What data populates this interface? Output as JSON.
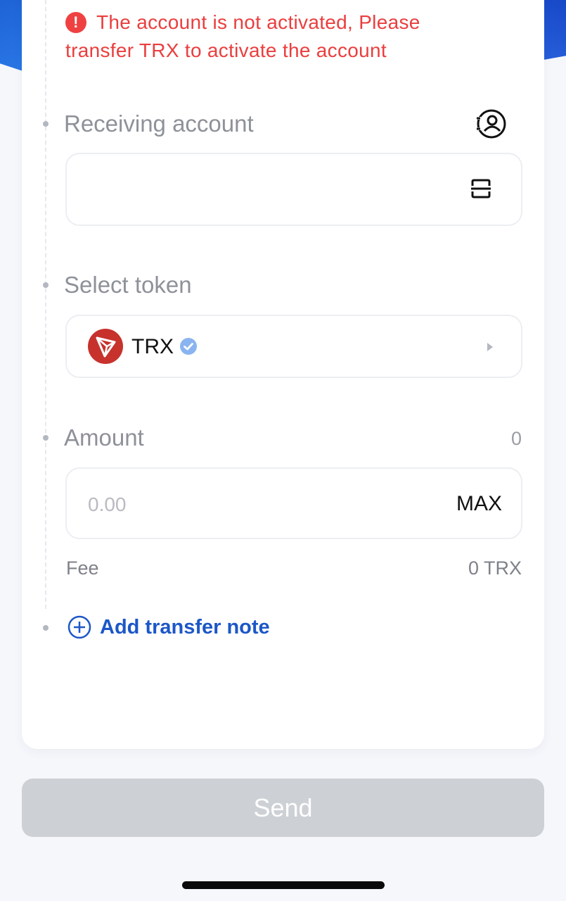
{
  "warning": {
    "text": "The account is not activated,  Please transfer TRX to activate the account",
    "icon": "exclamation-icon",
    "color": "#ea3e3e"
  },
  "receiving": {
    "label": "Receiving account",
    "contact_icon": "contact-book-icon",
    "scan_icon": "scan-icon"
  },
  "token": {
    "label": "Select token",
    "name": "TRX",
    "logo_icon": "tron-logo-icon",
    "verified_icon": "verified-badge-icon"
  },
  "amount": {
    "label": "Amount",
    "balance": "0",
    "placeholder": "0.00",
    "max_label": "MAX"
  },
  "fee": {
    "label": "Fee",
    "value": "0 TRX"
  },
  "note": {
    "label": "Add transfer note",
    "icon": "plus-circle-icon",
    "color": "#1c57c7"
  },
  "send": {
    "label": "Send",
    "color": "#cdd0d5"
  }
}
